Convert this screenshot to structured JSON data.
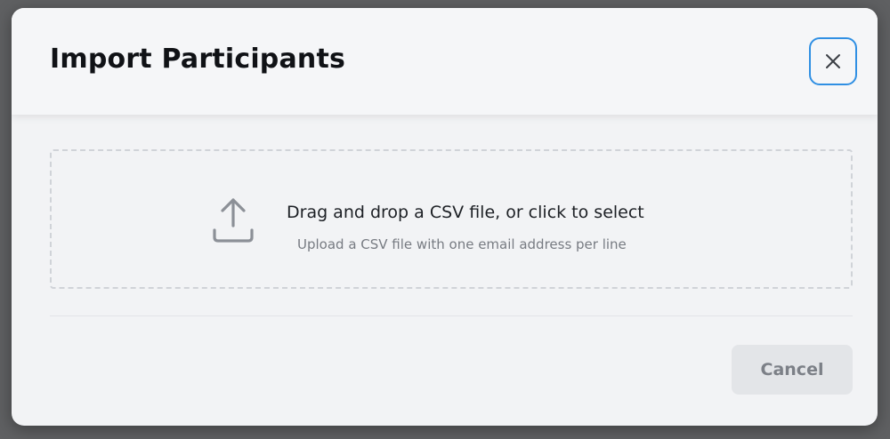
{
  "modal": {
    "title": "Import Participants",
    "close_icon": "close-icon"
  },
  "dropzone": {
    "icon": "upload-icon",
    "title": "Drag and drop a CSV file, or click to select",
    "subtitle": "Upload a CSV file with one email address per line"
  },
  "footer": {
    "cancel_label": "Cancel"
  },
  "colors": {
    "accent_focus": "#2f8fe3",
    "modal_background": "#f2f3f5",
    "backdrop": "#5f6062"
  }
}
